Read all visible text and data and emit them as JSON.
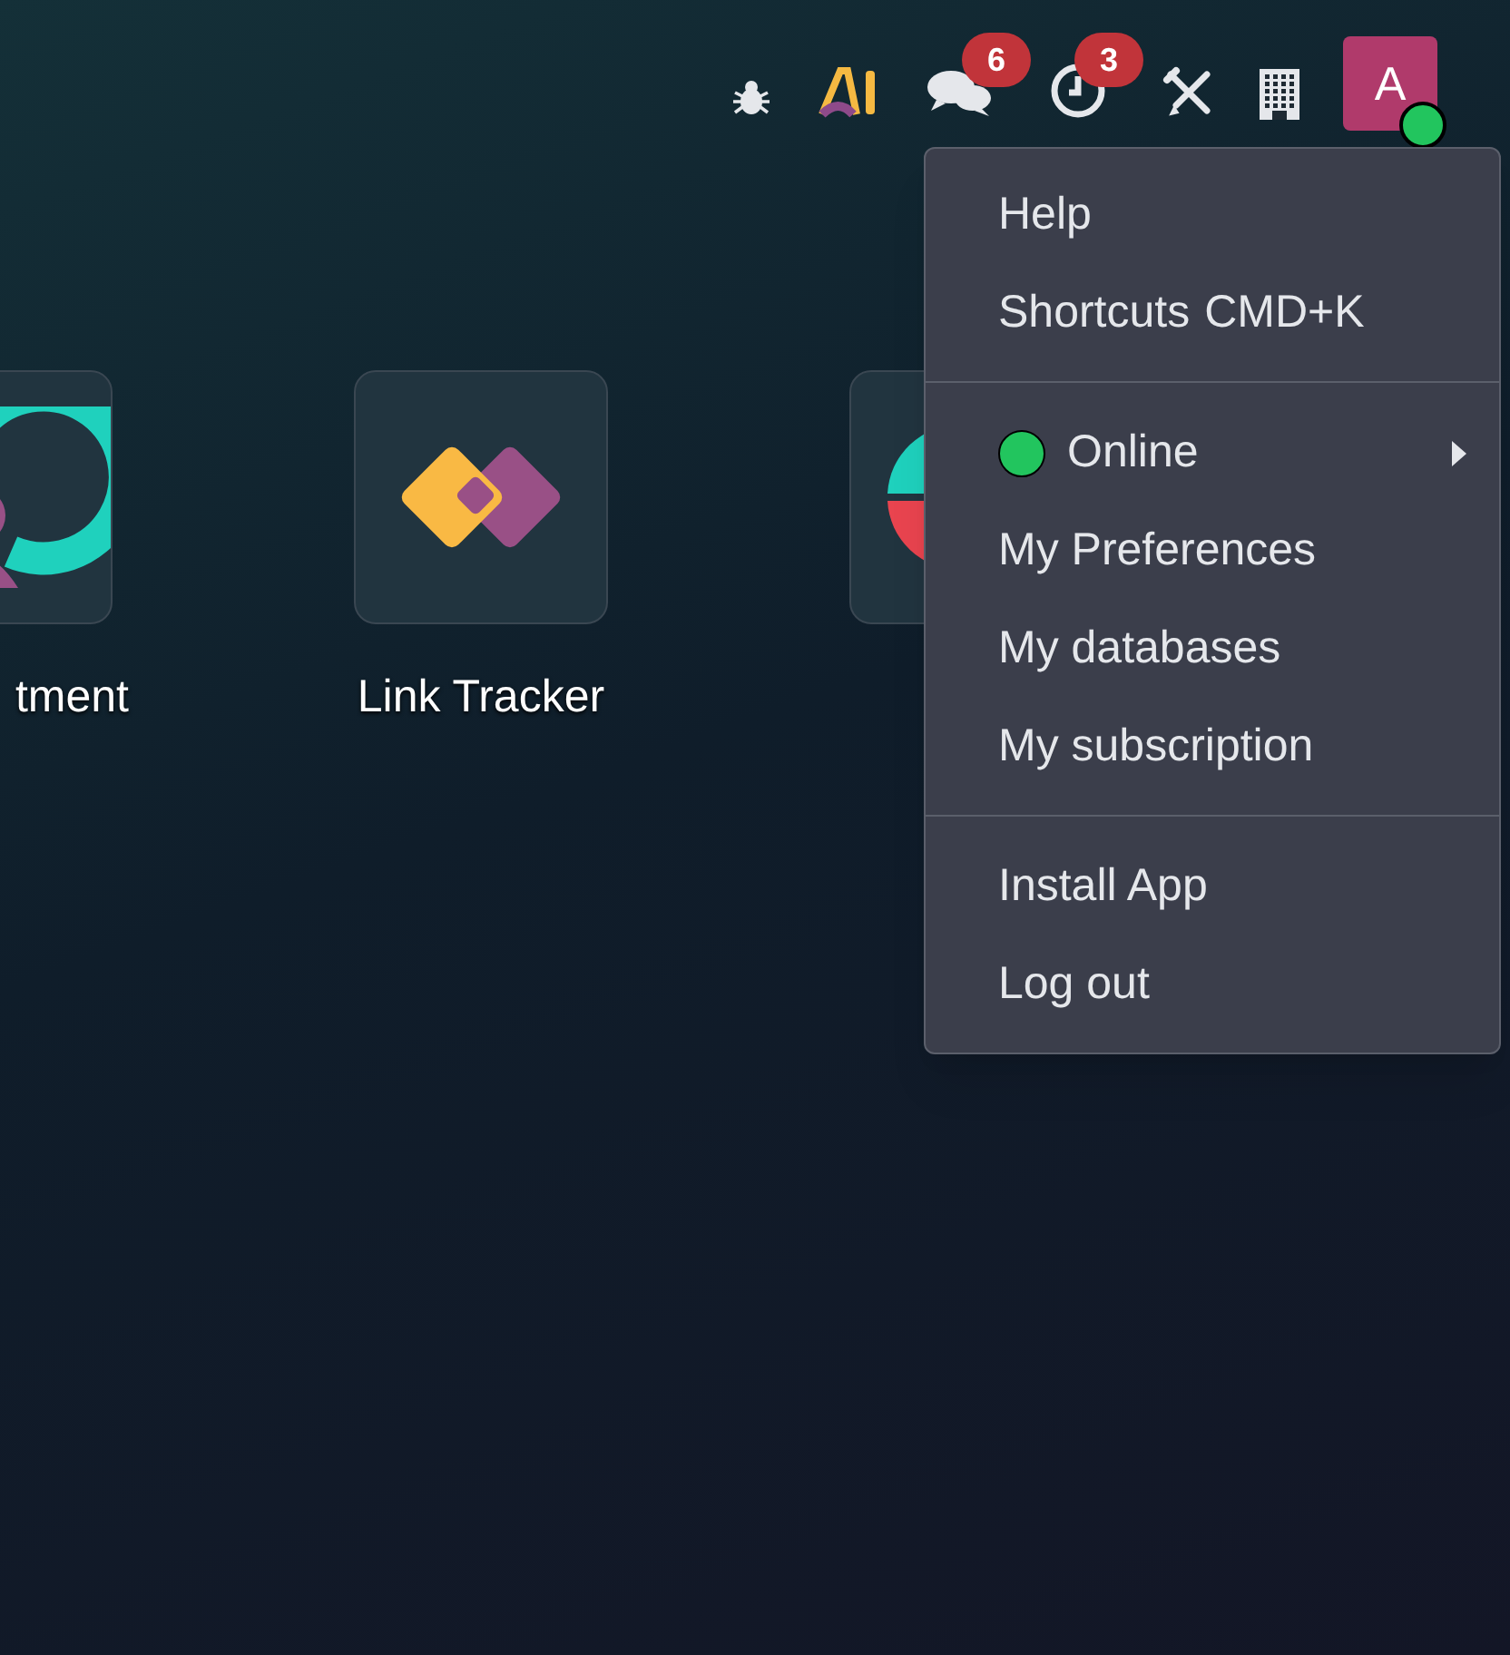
{
  "topbar": {
    "icons": [
      {
        "kind": "bug"
      },
      {
        "kind": "ai"
      },
      {
        "kind": "chat",
        "badge": "6"
      },
      {
        "kind": "clock",
        "badge": "3"
      },
      {
        "kind": "tools"
      },
      {
        "kind": "building"
      }
    ],
    "avatar": {
      "letter": "A",
      "online": true
    }
  },
  "apps": [
    {
      "kind": "appointment",
      "label": "tment",
      "cut": true
    },
    {
      "kind": "link",
      "label": "Link Tracker",
      "cut": false
    },
    {
      "kind": "split",
      "cut": false
    }
  ],
  "menu": {
    "sections": [
      [
        {
          "kind": "plain",
          "label": "Help"
        },
        {
          "kind": "shortcut",
          "label": "Shortcuts",
          "shortcut": "CMD+K"
        }
      ],
      [
        {
          "kind": "status",
          "label": "Online",
          "submenu": true
        },
        {
          "kind": "plain",
          "label": "My Preferences"
        },
        {
          "kind": "plain",
          "label": "My databases"
        },
        {
          "kind": "plain",
          "label": "My subscription"
        }
      ],
      [
        {
          "kind": "plain",
          "label": "Install App"
        },
        {
          "kind": "plain",
          "label": "Log out"
        }
      ]
    ]
  }
}
